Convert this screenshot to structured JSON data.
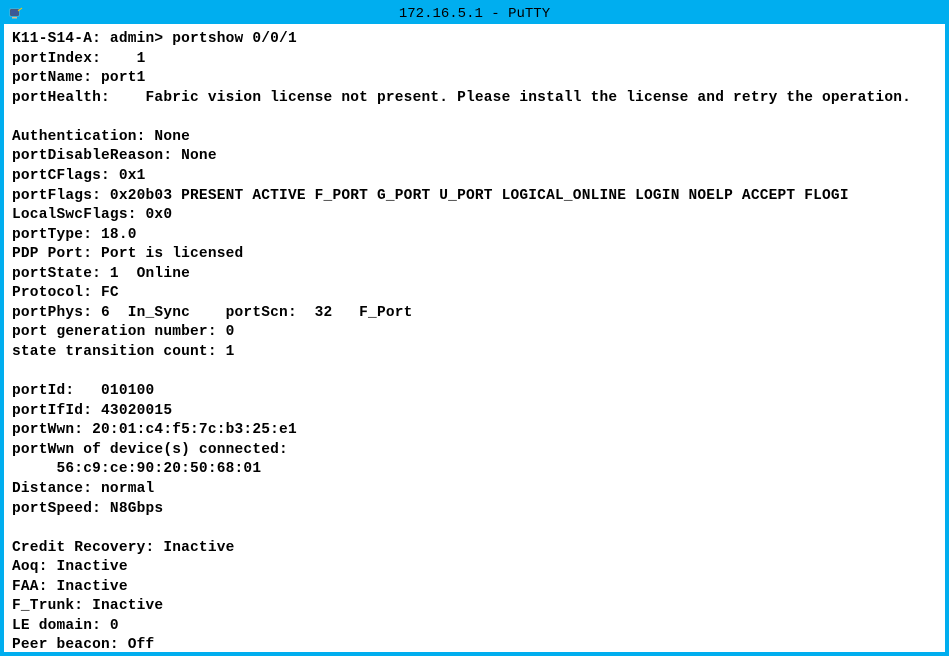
{
  "window": {
    "title": "172.16.5.1 - PuTTY"
  },
  "terminal": {
    "lines": [
      "K11-S14-A: admin> portshow 0/0/1",
      "portIndex:    1",
      "portName: port1",
      "portHealth:    Fabric vision license not present. Please install the license and retry the operation.",
      "",
      "Authentication: None",
      "portDisableReason: None",
      "portCFlags: 0x1",
      "portFlags: 0x20b03 PRESENT ACTIVE F_PORT G_PORT U_PORT LOGICAL_ONLINE LOGIN NOELP ACCEPT FLOGI",
      "LocalSwcFlags: 0x0",
      "portType: 18.0",
      "PDP Port: Port is licensed",
      "portState: 1  Online",
      "Protocol: FC",
      "portPhys: 6  In_Sync    portScn:  32   F_Port",
      "port generation number: 0",
      "state transition count: 1",
      "",
      "portId:   010100",
      "portIfId: 43020015",
      "portWwn: 20:01:c4:f5:7c:b3:25:e1",
      "portWwn of device(s) connected:",
      "     56:c9:ce:90:20:50:68:01",
      "Distance: normal",
      "portSpeed: N8Gbps ",
      "",
      "Credit Recovery: Inactive ",
      "Aoq: Inactive ",
      "FAA: Inactive ",
      "F_Trunk: Inactive ",
      "LE domain: 0",
      "Peer beacon: Off"
    ]
  }
}
